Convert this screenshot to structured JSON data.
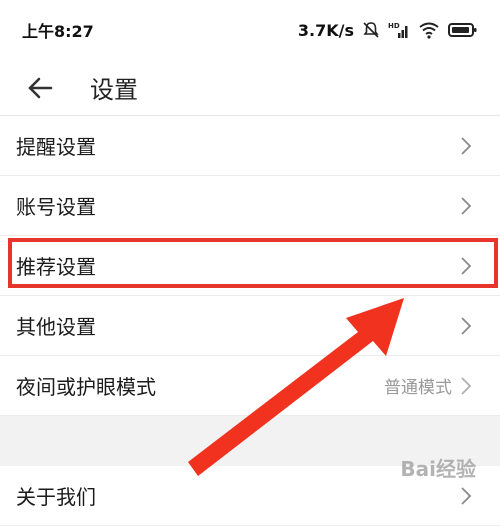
{
  "status": {
    "time": "上午8:27",
    "speed": "3.7K/s",
    "icons": [
      "mute-icon",
      "hd-signal-icon",
      "wifi-icon",
      "battery-icon"
    ]
  },
  "header": {
    "title": "设置",
    "back_icon": "arrow-left-icon"
  },
  "settings": {
    "reminder": "提醒设置",
    "account": "账号设置",
    "recommend": "推荐设置",
    "other": "其他设置",
    "night_mode": "夜间或护眼模式",
    "night_mode_value": "普通模式",
    "about": "关于我们"
  },
  "watermark": "Bai经验",
  "colors": {
    "highlight": "#e8352b",
    "chevron": "#8a8a8a"
  }
}
